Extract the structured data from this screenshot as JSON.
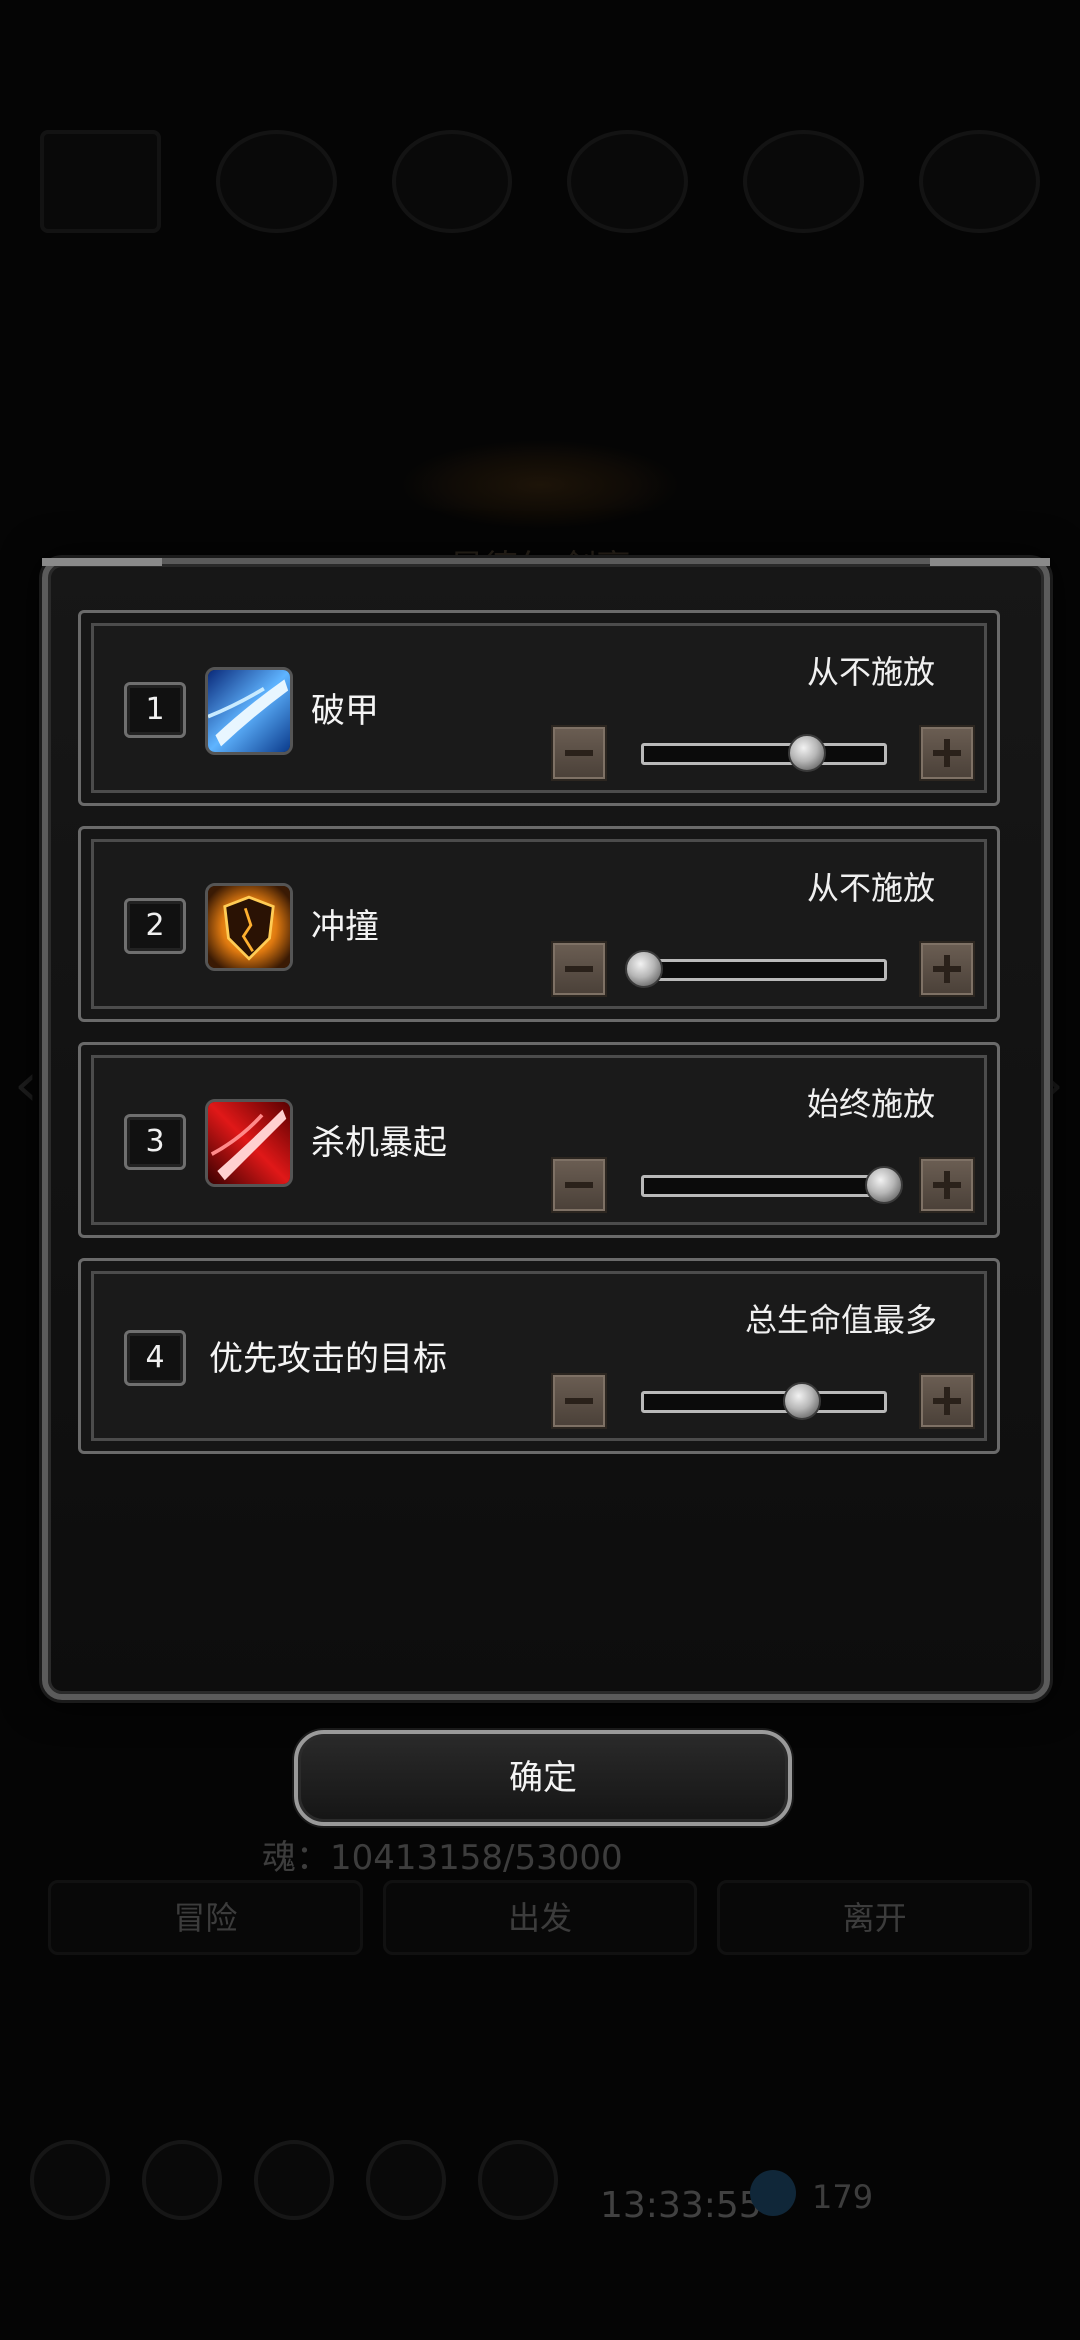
{
  "background": {
    "hero_name": "星德尔 剑豪",
    "soul_label": "魂：10413158/53000",
    "tabs": [
      "冒险",
      "出发",
      "离开"
    ],
    "time": "13:33:55",
    "currency_value": "179"
  },
  "dialog": {
    "rows": [
      {
        "index": "1",
        "name": "破甲",
        "icon": "armor-break-skill-icon",
        "mode": "从不施放",
        "slider_value": 0.68
      },
      {
        "index": "2",
        "name": "冲撞",
        "icon": "charge-shield-skill-icon",
        "mode": "从不施放",
        "slider_value": 0.0
      },
      {
        "index": "3",
        "name": "杀机暴起",
        "icon": "killing-intent-skill-icon",
        "mode": "始终施放",
        "slider_value": 1.0
      },
      {
        "index": "4",
        "name": "优先攻击的目标",
        "icon": null,
        "mode": "总生命值最多",
        "slider_value": 0.66
      }
    ],
    "confirm_label": "确定"
  },
  "colors": {
    "dialog_border": "#5b5b5b",
    "button_brown": "#6b5e53",
    "text": "#f0f0f0"
  }
}
